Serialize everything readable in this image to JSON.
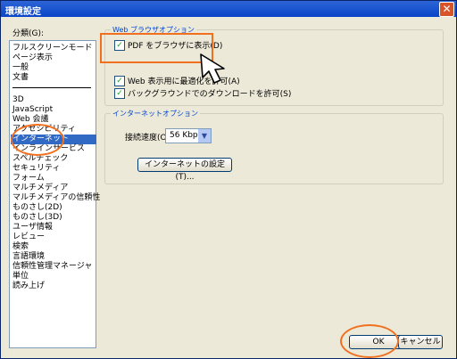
{
  "window": {
    "title": "環境設定",
    "close_glyph": "✕"
  },
  "categories": {
    "label": "分類(G):",
    "top_items": [
      "フルスクリーンモード",
      "ページ表示",
      "一般",
      "文書"
    ],
    "items": [
      "3D",
      "JavaScript",
      "Web 会議",
      "アクセシビリティ",
      "インターネット",
      "インラインサービス",
      "スペルチェック",
      "セキュリティ",
      "フォーム",
      "マルチメディア",
      "マルチメディアの信頼性",
      "ものさし(2D)",
      "ものさし(3D)",
      "ユーザ情報",
      "レビュー",
      "検索",
      "言語環境",
      "信頼性管理マネージャ",
      "単位",
      "読み上げ"
    ],
    "selected": "インターネット"
  },
  "web_browser_options": {
    "title": "Web ブラウザオプション",
    "checkboxes": [
      {
        "label": "PDF をブラウザに表示(D)",
        "checked": true
      },
      {
        "label": "Web 表示用に最適化を許可(A)",
        "checked": true
      },
      {
        "label": "バックグラウンドでのダウンロードを許可(S)",
        "checked": true
      }
    ]
  },
  "internet_options": {
    "title": "インターネットオプション",
    "speed_label": "接続速度(O):",
    "speed_value": "56 Kbps",
    "settings_button": "インターネットの設定(T)..."
  },
  "footer": {
    "ok": "OK",
    "cancel": "キャンセル"
  },
  "colors": {
    "highlight": "#f07020",
    "selection": "#316ac5",
    "title_bar": "#0a45c8"
  }
}
